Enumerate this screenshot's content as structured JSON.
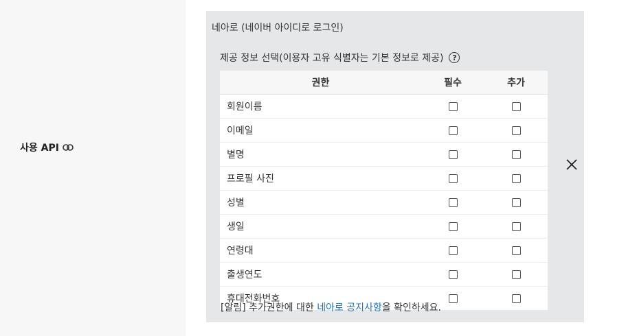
{
  "row_label": "사용 API",
  "provider_title": "네아로 (네이버 아이디로 로그인)",
  "section_title": "제공 정보 선택(이용자 고유 식별자는 기본 정보로 제공)",
  "help_symbol": "?",
  "table": {
    "columns": [
      "권한",
      "필수",
      "추가"
    ],
    "rows": [
      {
        "label": "회원이름",
        "required": false,
        "additional": false
      },
      {
        "label": "이메일",
        "required": false,
        "additional": false
      },
      {
        "label": "별명",
        "required": false,
        "additional": false
      },
      {
        "label": "프로필 사진",
        "required": false,
        "additional": false
      },
      {
        "label": "성별",
        "required": false,
        "additional": false
      },
      {
        "label": "생일",
        "required": false,
        "additional": false
      },
      {
        "label": "연령대",
        "required": false,
        "additional": false
      },
      {
        "label": "출생연도",
        "required": false,
        "additional": false
      },
      {
        "label": "휴대전화번호",
        "required": false,
        "additional": false
      }
    ]
  },
  "notice": {
    "prefix": "[알림] 추가권한에 대한 ",
    "link": "네아로 공지사항",
    "suffix": "을 확인하세요."
  },
  "colors": {
    "link": "#1a73c8",
    "panel_bg": "#e6e7e9",
    "left_bg": "#f7f7f8"
  },
  "icons": {
    "link": "link-icon",
    "help": "help-icon",
    "close": "close-icon"
  }
}
